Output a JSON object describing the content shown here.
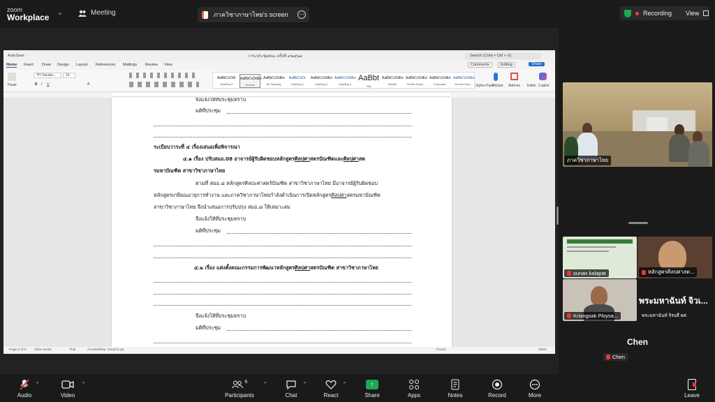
{
  "app": {
    "logo_line1": "zoom",
    "logo_line2": "Workplace",
    "meeting_label": "Meeting"
  },
  "share": {
    "title": "ภาควิชาภาษาไทย's screen"
  },
  "recording": {
    "label": "Recording",
    "view_label": "View"
  },
  "word": {
    "autosave": "AutoSave",
    "doc_name": "วาระประชุมคณะ ครั้งที่ ๙/๒๕๖๗",
    "search_placeholder": "Search (Cmd + Ctrl + U)",
    "menu": [
      "Home",
      "Insert",
      "Draw",
      "Design",
      "Layout",
      "References",
      "Mailings",
      "Review",
      "View"
    ],
    "comments": "Comments",
    "editing": "Editing",
    "share": "Share",
    "font": "TH Sarabu...",
    "font_size": "16",
    "paste": "Paste",
    "styles": [
      {
        "sample": "AaBbCcDdI",
        "name": "Heading 3"
      },
      {
        "sample": "AaBbCcDdEe",
        "name": "Normal"
      },
      {
        "sample": "AaBbCcDdEe",
        "name": "No Spacing"
      },
      {
        "sample": "AaBbCcDc",
        "name": "Heading 1"
      },
      {
        "sample": "AaBbCcDdEe",
        "name": "Heading 2"
      },
      {
        "sample": "AaBbCcDdEe",
        "name": "Heading 4"
      },
      {
        "sample": "AaBbt",
        "name": "Title"
      },
      {
        "sample": "AaBbCcDdEe",
        "name": "Subtitle"
      },
      {
        "sample": "AaBbCcDdEe",
        "name": "Subtle Emph..."
      },
      {
        "sample": "AaBbCcDdEe",
        "name": "Emphasis"
      },
      {
        "sample": "AaBbCcDdEe",
        "name": "Intense Emp..."
      }
    ],
    "ribbon_right": [
      "Styles Pane",
      "Dictate",
      "Add-ins",
      "Editor",
      "Copilot"
    ],
    "status": {
      "page": "Page 8 of 9",
      "words": "1024 words",
      "lang": "Thai",
      "accessibility": "Accessibility: Good to go",
      "focus": "Focus",
      "zoom": "200%"
    },
    "doc_lines": {
      "l1": "จึงแจ้งให้ที่ประชุมทราบ",
      "l2": "มติที่ประชุม",
      "heading4": "ระเบียบวาระที่ ๔ เรื่องเสนอเพื่อพิจารณา",
      "item41a": "๔.๑ เรื่อง ปรับสมอ.08 อาจารย์ผู้รับผิดชอบหลักสูตร",
      "item41b": "ศิลปศา",
      "item41c": "สตรบัณฑิตและ",
      "item41d": "ศิลปศา",
      "item41e": "สต",
      "item41f": "รมหาบัณฑิต สาขาวิชาภาษาไทย",
      "p1": "ตามที่ สมอ.๘ หลักสูตรศิลปะศาสตร์บัณฑิต สาขาวิชาภาษาไทย มีอาจารย์ผู้รับผิดชอบ",
      "p2a": "หลักสูตรเกษียณอายุการทำงาน และภาควิชาภาษาไทยกำลังดำเนินการเปิดหลักสูตร",
      "p2b": "ศิลปศา",
      "p2c": "สตรมหาบัณฑิต",
      "p3": "สาขาวิชาภาษาไทย จึงนำเสนอการปรับปรุง สมอ.๘ ให้เหมาะสม",
      "l3": "จึงแจ้งให้ที่ประชุมทราบ",
      "l4": "มติที่ประชุม",
      "item42a": "๔.๒ เรื่อง แต่งตั้งคณะกรรมการพัฒนาหลักสูตร",
      "item42b": "ศิลปศา",
      "item42c": "สตรบัณฑิต สาขาวิชาภาษาไทย",
      "l5": "จึงแจ้งให้ที่ประชุมทราบ",
      "l6": "มติที่ประชุม"
    }
  },
  "participants_tiles": {
    "t1": "ภาควิชาภาษาไทย",
    "t2": "sunan kalapat",
    "t3": "หลักสูตรศิลปศาสต...",
    "t4": "Kriangsak Ploysa...",
    "t5_big": "พระมหาฉันท์ จิวเ...",
    "t5": "พระมหาฉันท์ จิรมธี ผศ.",
    "chen_big": "Chen",
    "chen": "Chen",
    "slide_header": "..."
  },
  "toolbar": {
    "audio": "Audio",
    "video": "Video",
    "participants": "Participants",
    "participants_count": "6",
    "chat": "Chat",
    "react": "React",
    "share": "Share",
    "apps": "Apps",
    "notes": "Notes",
    "record": "Record",
    "more": "More",
    "leave": "Leave"
  },
  "colors": {
    "accent_blue": "#1f6cc8",
    "recording_red": "#e8464b",
    "share_green": "#1ea854"
  }
}
